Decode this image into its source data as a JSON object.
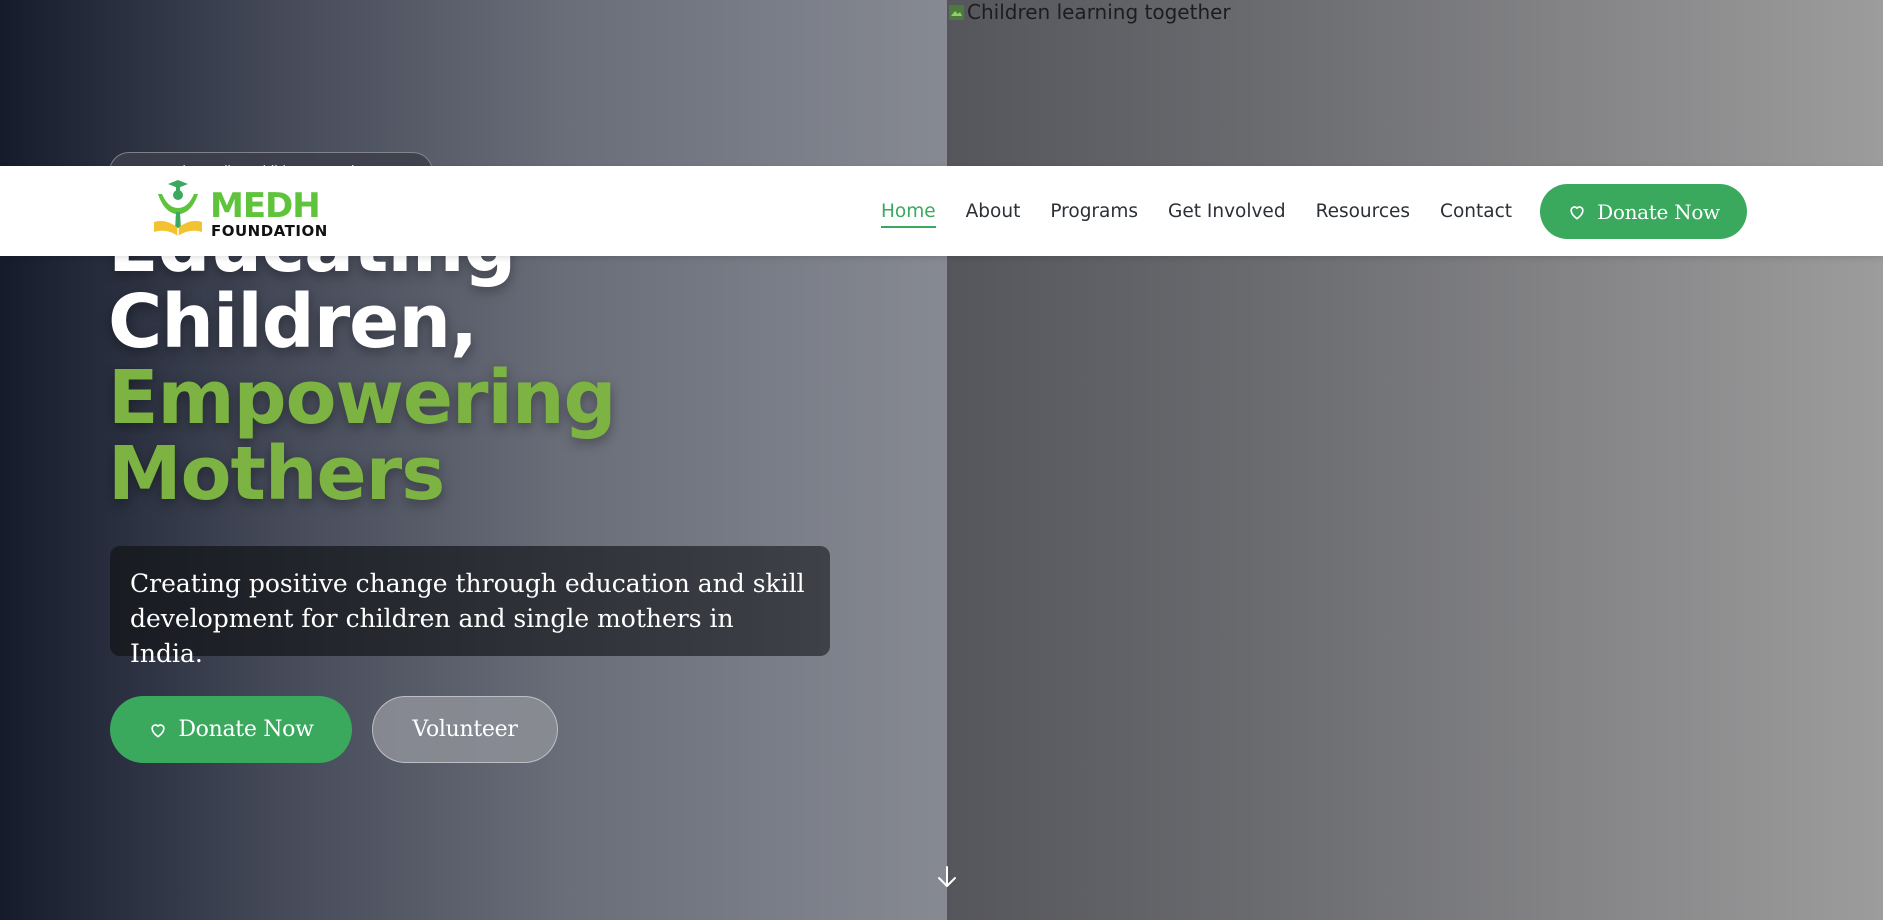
{
  "hero": {
    "image_alt": "Children learning together",
    "badge_text": "Supporting Indian Children & Mothers",
    "headline_line1": "Educating",
    "headline_line2": "Children,",
    "headline_line3": "Empowering",
    "headline_line4": "Mothers",
    "subtitle": "Creating positive change through education and skill development for children and single mothers in India.",
    "donate_button": "Donate Now",
    "volunteer_button": "Volunteer"
  },
  "nav": {
    "logo_word": "MEDH",
    "logo_sub": "FOUNDATION",
    "links": [
      {
        "label": "Home",
        "active": true
      },
      {
        "label": "About"
      },
      {
        "label": "Programs"
      },
      {
        "label": "Get Involved"
      },
      {
        "label": "Resources"
      },
      {
        "label": "Contact"
      }
    ],
    "donate_button": "Donate Now"
  },
  "icons": {
    "donate": "heart-icon",
    "scroll": "arrow-down-icon",
    "image": "broken-image-icon"
  },
  "colors": {
    "accent_green": "#3aa95e",
    "headline_green": "#7cb342",
    "logo_green": "#5fc33b"
  }
}
